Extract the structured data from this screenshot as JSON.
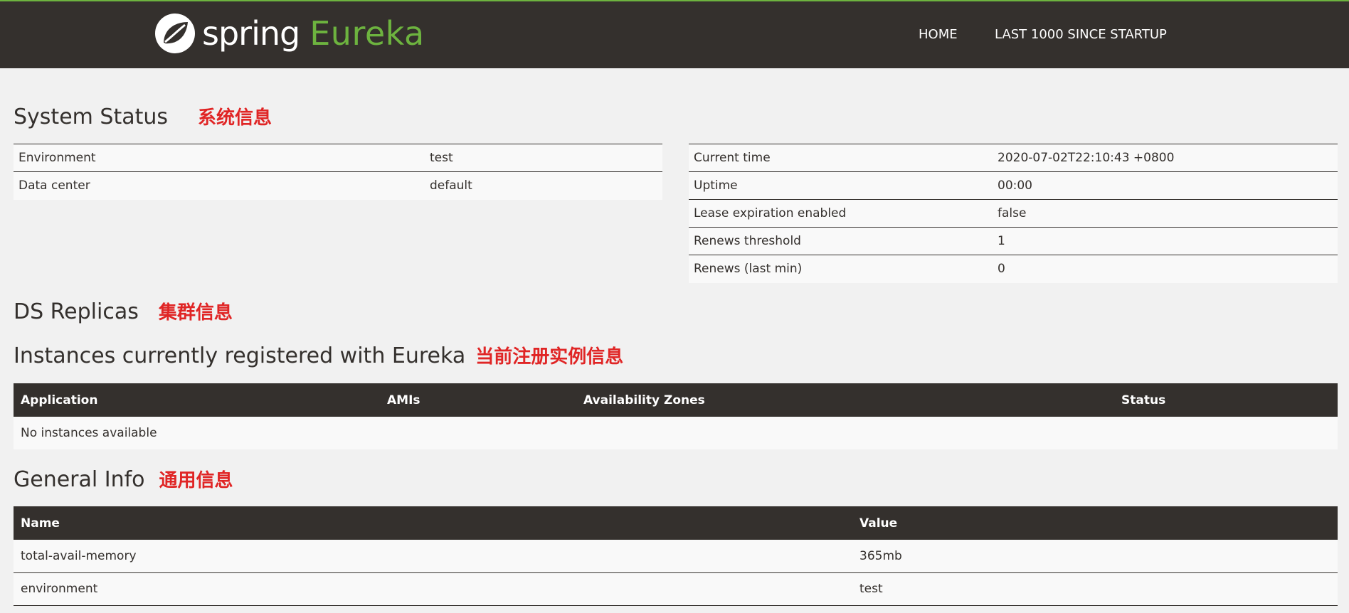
{
  "header": {
    "logo_word1": "spring",
    "logo_word2": "Eureka",
    "nav": {
      "home": "HOME",
      "last1000": "LAST 1000 SINCE STARTUP"
    }
  },
  "system_status": {
    "title": "System Status",
    "annotation": "系统信息",
    "left": [
      {
        "label": "Environment",
        "value": "test"
      },
      {
        "label": "Data center",
        "value": "default"
      }
    ],
    "right": [
      {
        "label": "Current time",
        "value": "2020-07-02T22:10:43 +0800"
      },
      {
        "label": "Uptime",
        "value": "00:00"
      },
      {
        "label": "Lease expiration enabled",
        "value": "false"
      },
      {
        "label": "Renews threshold",
        "value": "1"
      },
      {
        "label": "Renews (last min)",
        "value": "0"
      }
    ]
  },
  "ds_replicas": {
    "title": "DS Replicas",
    "annotation": "集群信息"
  },
  "instances": {
    "title": "Instances currently registered with Eureka",
    "annotation": "当前注册实例信息",
    "columns": [
      "Application",
      "AMIs",
      "Availability Zones",
      "Status"
    ],
    "empty_message": "No instances available"
  },
  "general_info": {
    "title": "General Info",
    "annotation": "通用信息",
    "columns": [
      "Name",
      "Value"
    ],
    "rows": [
      {
        "name": "total-avail-memory",
        "value": "365mb"
      },
      {
        "name": "environment",
        "value": "test"
      }
    ]
  },
  "colors": {
    "header_bg": "#34302d",
    "brand_green": "#6db33f",
    "annotation_red": "#e02525"
  }
}
